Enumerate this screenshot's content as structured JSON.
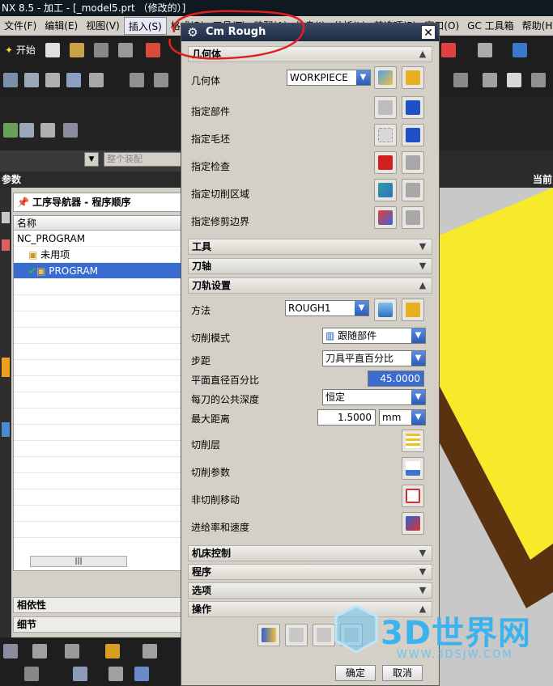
{
  "window": {
    "title": "NX 8.5 - 加工 - [_model5.prt （修改的）]"
  },
  "menu": {
    "items": [
      "文件(F)",
      "编辑(E)",
      "视图(V)",
      "插入(S)",
      "格式(R)",
      "工具(T)",
      "装配(A)",
      "信息(I)",
      "分析(L)",
      "首选项(P)",
      "窗口(O)",
      "GC 工具箱",
      "帮助(H)"
    ],
    "active_index": 3
  },
  "toolbar": {
    "start_label": "开始"
  },
  "left": {
    "assembly_filter": "整个装配",
    "params_label": "参数",
    "navigator_title": "工序导航器 - 程序顺序",
    "column_name": "名称",
    "tree": [
      {
        "label": "NC_PROGRAM",
        "level": 0
      },
      {
        "label": "未用项",
        "level": 1
      },
      {
        "label": "PROGRAM",
        "level": 1,
        "selected": true
      }
    ],
    "dependency_label": "相依性",
    "detail_label": "细节",
    "current_label": "当前"
  },
  "dialog": {
    "title": "Cm Rough",
    "sections": {
      "geometry": "几何体",
      "tool": "工具",
      "axis": "刀轴",
      "path_settings": "刀轨设置",
      "machine_control": "机床控制",
      "program": "程序",
      "options": "选项",
      "actions": "操作"
    },
    "geometry": {
      "label": "几何体",
      "value": "WORKPIECE",
      "specify_part": "指定部件",
      "specify_blank": "指定毛坯",
      "specify_check": "指定检查",
      "specify_cut_area": "指定切削区域",
      "specify_trim": "指定修剪边界"
    },
    "path": {
      "method_label": "方法",
      "method_value": "ROUGH1",
      "cut_pattern_label": "切削模式",
      "cut_pattern_value": "跟随部件",
      "stepover_label": "步距",
      "stepover_value": "刀具平直百分比",
      "flat_pct_label": "平面直径百分比",
      "flat_pct_value": "45.0000",
      "common_depth_label": "每刀的公共深度",
      "common_depth_value": "恒定",
      "max_distance_label": "最大距离",
      "max_distance_value": "1.5000",
      "unit": "mm",
      "cut_levels": "切削层",
      "cut_params": "切削参数",
      "non_cut_moves": "非切削移动",
      "feeds_speeds": "进给率和速度"
    },
    "ok_label": "确定",
    "cancel_label": "取消"
  },
  "watermark": {
    "brand": "3D世界网",
    "url": "WWW.3DSJW.COM"
  },
  "colors": {
    "viewport_yellow": "#f7ea2a",
    "viewport_brown": "#5a3210",
    "selection": "#3a6ccf"
  }
}
